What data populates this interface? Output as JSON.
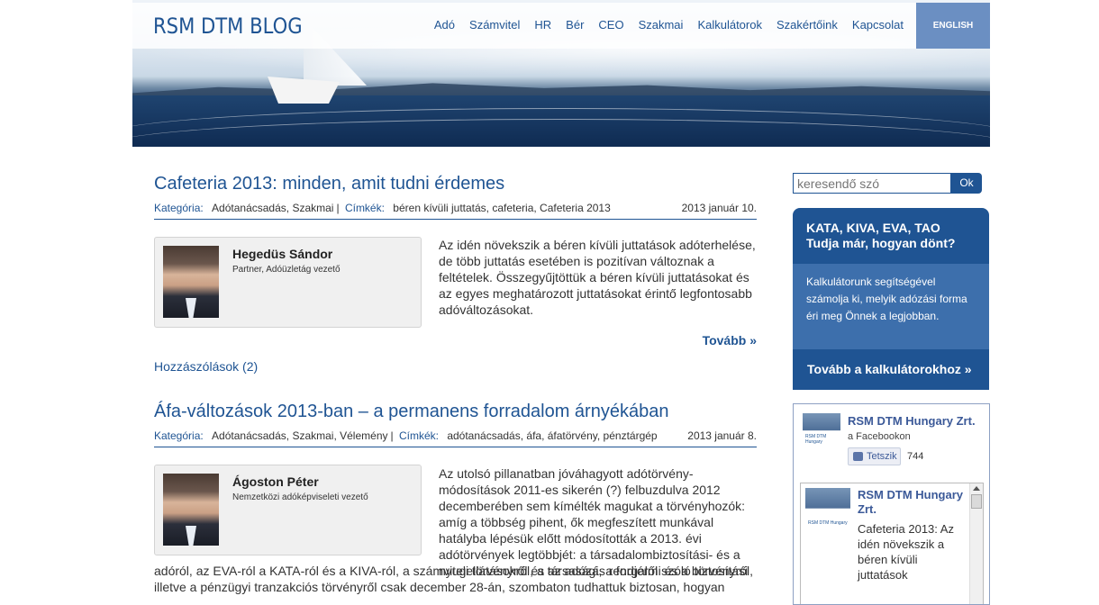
{
  "header": {
    "logo": "RSM DTM BLOG",
    "menu": [
      "Adó",
      "Számvitel",
      "HR",
      "Bér",
      "CEO",
      "Szakmai",
      "Kalkulátorok",
      "Szakértőink",
      "Kapcsolat"
    ],
    "english": "ENGLISH"
  },
  "posts": [
    {
      "title": "Cafeteria 2013: minden, amit tudni érdemes",
      "category_label": "Kategória:",
      "categories": "Adótanácsadás, Szakmai",
      "tags_label": "Címkék:",
      "tags": "béren kívüli juttatás, cafeteria, Cafeteria 2013",
      "date": "2013 január 10.",
      "author_name": "Hegedüs Sándor",
      "author_role": "Partner, Adóüzletág vezető",
      "excerpt": "Az idén növekszik a béren kívüli juttatások adóterhelése, de több juttatás esetében is pozitívan változnak a feltételek. Összegyűjtöttük a béren kívüli juttatásokat és az egyes meghatározott juttatásokat érintő legfontosabb adóváltozásokat.",
      "more": "Tovább »",
      "comments": "Hozzászólások (2)"
    },
    {
      "title": "Áfa-változások 2013-ban – a permanens forradalom árnyékában",
      "category_label": "Kategória:",
      "categories": "Adótanácsadás, Szakmai, Vélemény",
      "tags_label": "Címkék:",
      "tags": "adótanácsadás, áfa, áfatörvény, pénztárgép",
      "date": "2013 január 8.",
      "author_name": "Ágoston Péter",
      "author_role": "Nemzetközi adóképviseleti vezető",
      "excerpt_side": "Az utolsó pillanatban jóváhagyott adótörvény-módosítások 2011-es sikerén (?) felbuzdulva 2012 decemberében sem kímélték magukat a törvényhozók: amíg a többség pihent, ők megfeszített munkával hatályba lépésük előtt módosították a 2013. évi adótörvények legtöbbjét: a társadalombiztosítási- és a nyugellátásokról, a társasági, a forgalmi és a biztosítási",
      "excerpt_full": "adóról, az EVA-ról a KATA-ról és a KIVA-ról, a számviteli törvényről és az adózás rendjéről szóló törvényről, illetve a pénzügyi tranzakciós törvényről csak december 28-án, szombaton tudhattuk biztosan, hogyan"
    }
  ],
  "sidebar": {
    "search_placeholder": "keresendő szó",
    "search_button": "Ok",
    "promo_title": "KATA, KIVA, EVA, TAO Tudja már, hogyan dönt?",
    "promo_text": "Kalkulátorunk segítségével számolja ki, melyik adózási forma éri meg Önnek a legjobban.",
    "promo_link": "Tovább a kalkulátorokhoz »",
    "fb": {
      "page_name": "RSM DTM Hungary Zrt.",
      "sub": "a Facebookon",
      "like": "Tetszik",
      "count": "744",
      "thumb_caption": "RSM DTM Hungary",
      "post_author": "RSM DTM Hungary Zrt.",
      "post_text": "Cafeteria 2013: Az idén növekszik a béren kívüli juttatások"
    }
  }
}
